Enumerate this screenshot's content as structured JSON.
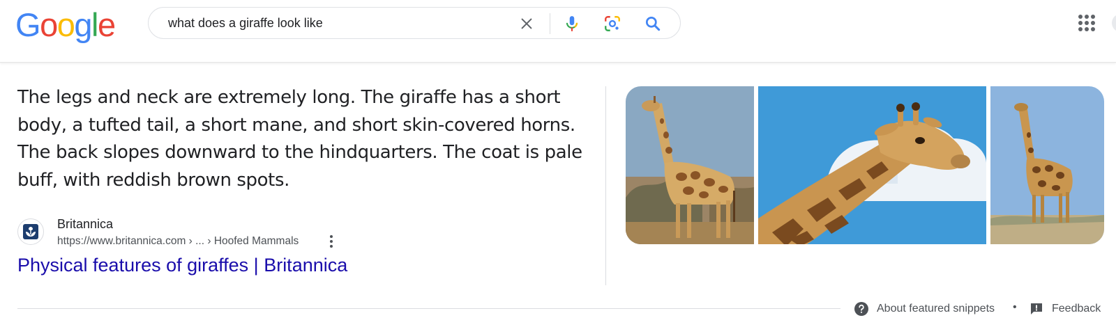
{
  "header": {
    "logo_letters": [
      "G",
      "o",
      "o",
      "g",
      "l",
      "e"
    ],
    "search_query": "what does a giraffe look like"
  },
  "icons": {
    "clear": "close-icon",
    "voice": "microphone-icon",
    "lens": "camera-lens-icon",
    "search": "search-icon",
    "apps": "apps-grid-icon"
  },
  "colors": {
    "google_blue": "#4285F4",
    "google_red": "#EA4335",
    "google_yellow": "#FBBC05",
    "google_green": "#34A853",
    "link": "#1a0dab"
  },
  "snippet": {
    "text": "The legs and neck are extremely long. The giraffe has a short body, a tufted tail, a short mane, and short skin-covered horns. The back slopes downward to the hindquarters. The coat is pale buff, with reddish brown spots.",
    "source_name": "Britannica",
    "source_url": "https://www.britannica.com › ... › Hoofed Mammals",
    "link_title": "Physical features of giraffes | Britannica"
  },
  "footer": {
    "about_label": "About featured snippets",
    "separator": "•",
    "feedback_label": "Feedback"
  }
}
